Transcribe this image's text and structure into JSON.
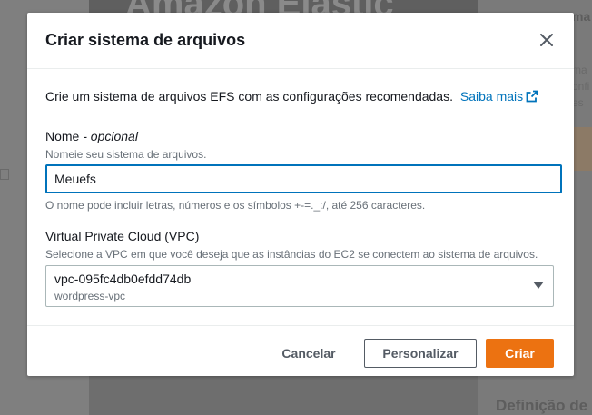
{
  "background": {
    "hero_text": "Amazon Elastic",
    "right_fragment": "ma",
    "right_lines": [
      "ma",
      "onfi",
      "es"
    ],
    "right_title": "Definição de"
  },
  "modal": {
    "title": "Criar sistema de arquivos",
    "intro": "Crie um sistema de arquivos EFS com as configurações recomendadas.",
    "learn_more": "Saiba mais",
    "name_field": {
      "label": "Nome",
      "label_suffix": " - opcional",
      "description": "Nomeie seu sistema de arquivos.",
      "value": "Meuefs",
      "hint": "O nome pode incluir letras, números e os símbolos +-=._:/, até 256 caracteres."
    },
    "vpc_field": {
      "label": "Virtual Private Cloud (VPC)",
      "description": "Selecione a VPC em que você deseja que as instâncias do EC2 se conectem ao sistema de arquivos.",
      "selected_id": "vpc-095fc4db0efdd74db",
      "selected_name": "wordpress-vpc"
    },
    "buttons": {
      "cancel": "Cancelar",
      "customize": "Personalizar",
      "create": "Criar"
    }
  },
  "colors": {
    "link": "#0073bb",
    "primary": "#ec7211",
    "overlay": "#7f7f7f"
  },
  "icons": [
    "close-icon",
    "external-link-icon",
    "caret-down-icon"
  ]
}
